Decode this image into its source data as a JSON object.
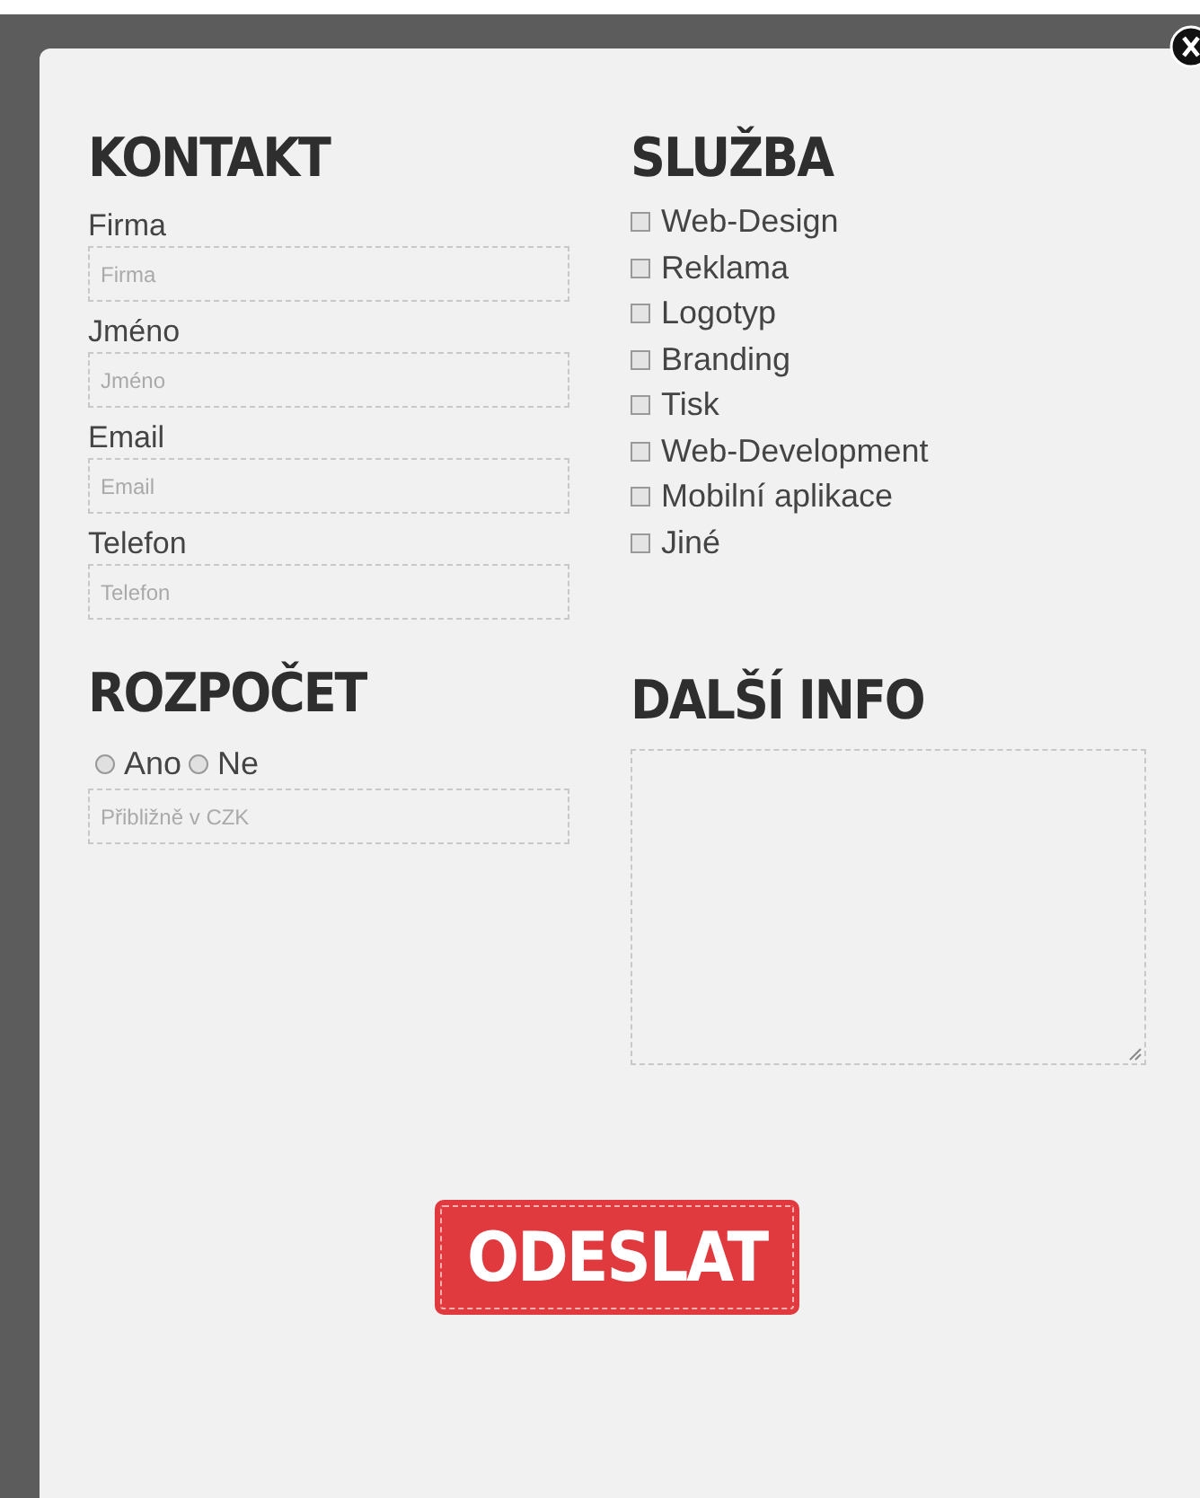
{
  "contact": {
    "heading": "KONTAKT",
    "fields": [
      {
        "label": "Firma",
        "placeholder": "Firma"
      },
      {
        "label": "Jméno",
        "placeholder": "Jméno"
      },
      {
        "label": "Email",
        "placeholder": "Email"
      },
      {
        "label": "Telefon",
        "placeholder": "Telefon"
      }
    ]
  },
  "service": {
    "heading": "SLUŽBA",
    "options": [
      {
        "label": "Web-Design",
        "checked": false
      },
      {
        "label": "Reklama",
        "checked": false
      },
      {
        "label": "Logotyp",
        "checked": false
      },
      {
        "label": "Branding",
        "checked": false
      },
      {
        "label": "Tisk",
        "checked": false
      },
      {
        "label": "Web-Development",
        "checked": false
      },
      {
        "label": "Mobilní aplikace",
        "checked": false
      },
      {
        "label": "Jiné",
        "checked": false
      }
    ]
  },
  "budget": {
    "heading": "ROZPOČET",
    "choices": [
      {
        "label": "Ano",
        "selected": false
      },
      {
        "label": "Ne",
        "selected": false
      }
    ],
    "placeholder": "Přibližně v CZK"
  },
  "info": {
    "heading": "DALŠÍ INFO"
  },
  "submit": "ODESLAT"
}
